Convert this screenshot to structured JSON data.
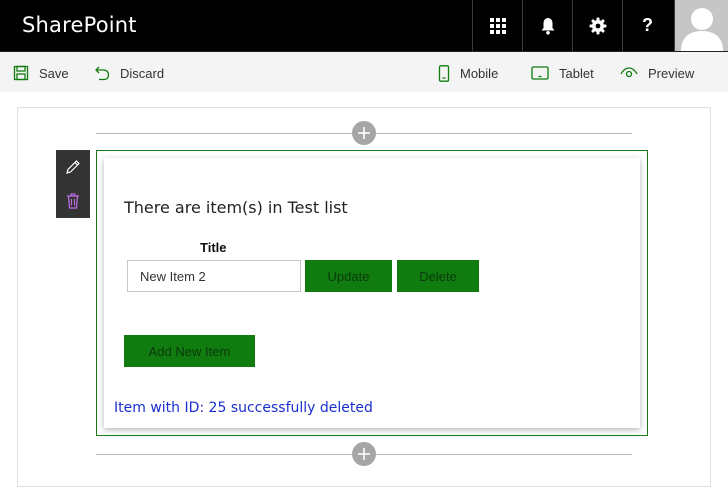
{
  "suitebar": {
    "brand": "SharePoint",
    "help_glyph": "?",
    "icons": [
      "waffle-icon",
      "bell-icon",
      "gear-icon",
      "help-icon",
      "avatar"
    ]
  },
  "commandbar": {
    "save_label": "Save",
    "discard_label": "Discard",
    "mobile_label": "Mobile",
    "tablet_label": "Tablet",
    "preview_label": "Preview"
  },
  "webpart": {
    "heading": "There are item(s) in Test list",
    "column_title": "Title",
    "item_title_value": "New Item 2",
    "update_label": "Update",
    "delete_label": "Delete",
    "add_label": "Add New Item",
    "status_message": "Item with ID: 25 successfully deleted"
  },
  "colors": {
    "suitebar_bg": "#000000",
    "button_green": "#107c10",
    "zone_border": "#1a7a1a",
    "status_text": "#1a2fd1"
  }
}
